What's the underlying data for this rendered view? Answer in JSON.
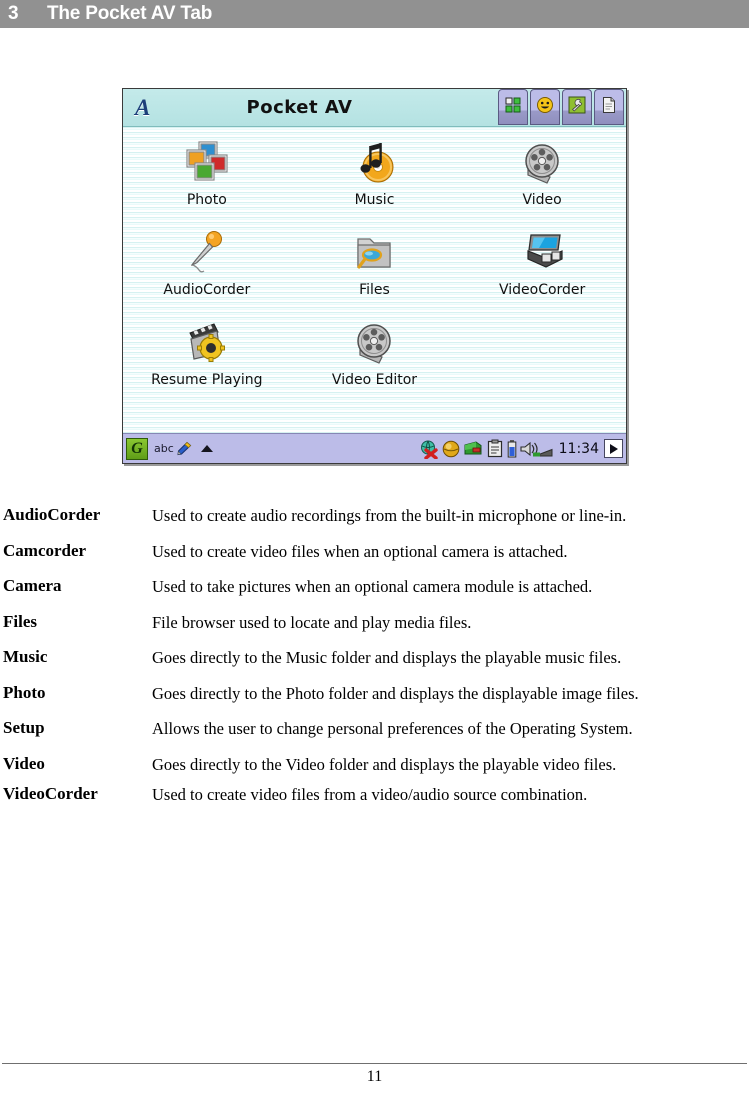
{
  "chapter": {
    "number": "3",
    "title": "The Pocket AV Tab"
  },
  "device": {
    "titlebar": {
      "logo": "A",
      "title": "Pocket AV",
      "buttons": [
        {
          "name": "blocks-icon",
          "tooltip": "Blocks"
        },
        {
          "name": "smiley-icon",
          "tooltip": "Smiley"
        },
        {
          "name": "wrench-icon",
          "tooltip": "Tools"
        },
        {
          "name": "document-icon",
          "tooltip": "Document"
        }
      ]
    },
    "apps": [
      {
        "label": "Photo",
        "icon": "photos-stack-icon"
      },
      {
        "label": "Music",
        "icon": "music-note-cd-icon"
      },
      {
        "label": "Video",
        "icon": "film-reel-icon"
      },
      {
        "label": "AudioCorder",
        "icon": "microphone-icon"
      },
      {
        "label": "Files",
        "icon": "folder-magnifier-icon"
      },
      {
        "label": "VideoCorder",
        "icon": "camcorder-icon"
      },
      {
        "label": "Resume Playing",
        "icon": "clapperboard-gear-icon"
      },
      {
        "label": "Video Editor",
        "icon": "film-reel-icon"
      }
    ],
    "taskbar": {
      "start_label": "G",
      "sip_label": "abc",
      "clock": "11:34",
      "tray_icons": [
        "network-disconnected-icon",
        "globe-icon",
        "wallet-icon",
        "clipboard-icon",
        "battery-icon",
        "volume-icon"
      ]
    }
  },
  "definitions": [
    {
      "term": "AudioCorder",
      "desc": "Used to create audio recordings from the built-in microphone or line-in."
    },
    {
      "term": "Camcorder",
      "desc": "Used to create video files when an optional camera is attached."
    },
    {
      "term": "Camera",
      "desc": "Used to take pictures when an optional camera module is attached."
    },
    {
      "term": "Files",
      "desc": "File browser used to locate and play media files."
    },
    {
      "term": "Music",
      "desc": "Goes directly to the Music folder and displays the playable music files."
    },
    {
      "term": "Photo",
      "desc": "Goes directly to the Photo folder and displays the displayable image files."
    },
    {
      "term": "Setup",
      "desc": "Allows the user to change personal preferences of the Operating System."
    },
    {
      "term": "Video",
      "desc": "Goes directly to the Video folder and displays the playable video files."
    },
    {
      "term": "VideoCorder",
      "desc": "Used to create video files from a video/audio source combination."
    }
  ],
  "footer": {
    "page_number": "11"
  },
  "colors": {
    "header_bar": "#919191",
    "titlebar": "#b8e4e4",
    "taskbar": "#bcbce8",
    "toolbar_button": "#bcbce8",
    "stripe": "#d6f1f1",
    "start_button": "#7ec22c"
  }
}
